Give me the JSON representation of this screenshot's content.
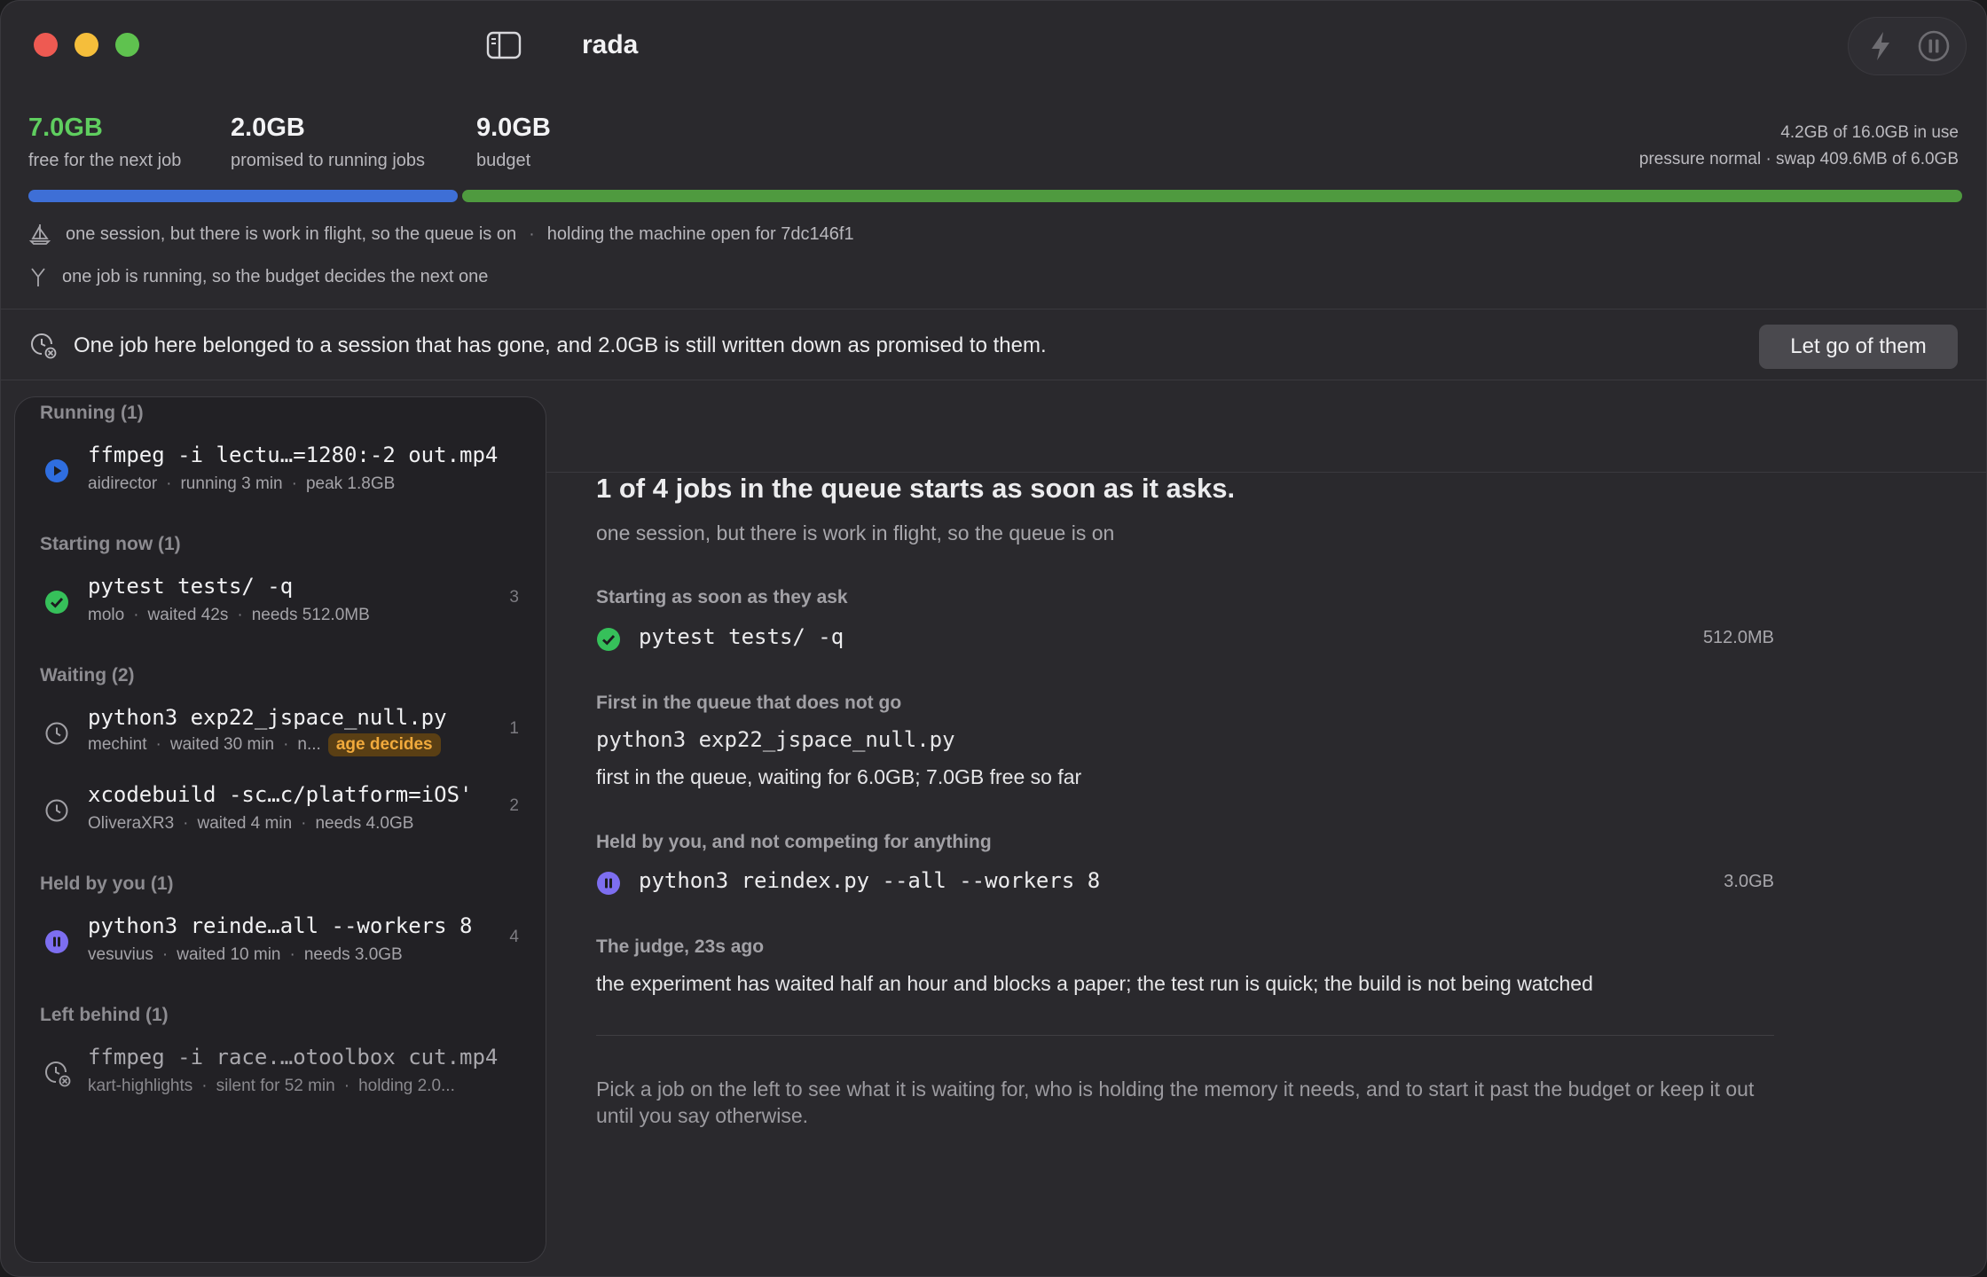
{
  "window": {
    "title": "rada",
    "traffic_lights": {
      "close": "#ee5a52",
      "minimize": "#f5be3b",
      "zoom": "#5fc24f"
    },
    "sidebar_toggle_icon": "sidebar-toggle-icon",
    "toolbar": {
      "boost_icon": "bolt-icon",
      "pause_icon": "pause-circle-icon"
    }
  },
  "memory": {
    "free": {
      "value": "7.0GB",
      "label": "free for the next job",
      "color": "#5fce5f"
    },
    "promised": {
      "value": "2.0GB",
      "label": "promised to running jobs"
    },
    "budget": {
      "value": "9.0GB",
      "label": "budget"
    },
    "in_use": "4.2GB of 16.0GB in use",
    "pressure": "pressure normal · swap 409.6MB of 6.0GB",
    "bar": {
      "promised_fraction": 0.222,
      "free_fraction": 0.778,
      "promised_color": "#3e6fd6",
      "free_color": "#4f9a3f"
    }
  },
  "status": {
    "queue_line": "one session, but there is work in flight, so the queue is on",
    "hold_line": "holding the machine open for 7dc146f1",
    "budget_line": "one job is running, so the budget decides the next one"
  },
  "banner": {
    "text": "One job here belonged to a session that has gone, and 2.0GB is still written down as promised to them.",
    "button": "Let go of them"
  },
  "sidebar": {
    "running": {
      "heading": "Running (1)",
      "jobs": [
        {
          "title": "ffmpeg -i lectu…=1280:-2 out.mp4",
          "owner": "aidirector",
          "time": "running 3 min",
          "mem": "peak 1.8GB"
        }
      ]
    },
    "starting": {
      "heading": "Starting now (1)",
      "jobs": [
        {
          "title": "pytest tests/ -q",
          "owner": "molo",
          "time": "waited 42s",
          "mem": "needs 512.0MB",
          "num": "3"
        }
      ]
    },
    "waiting": {
      "heading": "Waiting (2)",
      "jobs": [
        {
          "title": "python3 exp22_jspace_null.py",
          "owner": "mechint",
          "time": "waited 30 min",
          "mem": "n...",
          "badge": "age decides",
          "num": "1"
        },
        {
          "title": "xcodebuild -sc…c/platform=iOS'",
          "owner": "OliveraXR3",
          "time": "waited 4 min",
          "mem": "needs 4.0GB",
          "num": "2"
        }
      ]
    },
    "held": {
      "heading": "Held by you (1)",
      "jobs": [
        {
          "title": "python3 reinde…all --workers 8",
          "owner": "vesuvius",
          "time": "waited 10 min",
          "mem": "needs 3.0GB",
          "num": "4"
        }
      ]
    },
    "left_behind": {
      "heading": "Left behind (1)",
      "jobs": [
        {
          "title": "ffmpeg -i race.…otoolbox cut.mp4",
          "owner": "kart-highlights",
          "time": "silent for 52 min",
          "mem": "holding 2.0..."
        }
      ]
    }
  },
  "main": {
    "headline": "1 of 4 jobs in the queue starts as soon as it asks.",
    "subline": "one session, but there is work in flight, so the queue is on",
    "starting_label": "Starting as soon as they ask",
    "starting_job": {
      "title": "pytest tests/ -q",
      "size": "512.0MB"
    },
    "first_label": "First in the queue that does not go",
    "first_job": "python3 exp22_jspace_null.py",
    "first_reason": "first in the queue, waiting for 6.0GB; 7.0GB free so far",
    "held_label": "Held by you, and not competing for anything",
    "held_job": {
      "title": "python3 reindex.py --all --workers 8",
      "size": "3.0GB"
    },
    "judge_label": "The judge, 23s ago",
    "judge_text": "the experiment has waited half an hour and blocks a paper; the test run is quick; the build is not being watched",
    "help": "Pick a job on the left to see what it is waiting for, who is holding the memory it needs, and to start it past the budget or keep it out until you say otherwise."
  }
}
